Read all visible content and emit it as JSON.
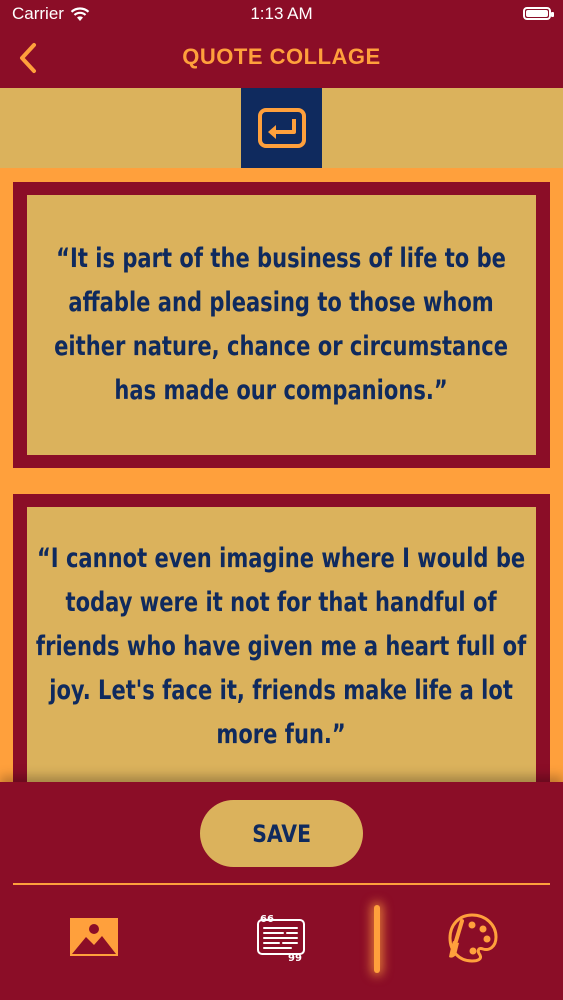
{
  "status": {
    "carrier": "Carrier",
    "time": "1:13 AM"
  },
  "nav": {
    "title": "QUOTE COLLAGE",
    "back_icon": "chevron-left-icon"
  },
  "toolbar": {
    "undo_icon": "undo-return-icon"
  },
  "quotes": [
    "“It is part of the business of life to be affable and pleasing to those whom either nature, chance or circumstance has made our companions.”",
    "“I cannot even imagine where I would be today were it not for that handful of friends who have given me a heart full of joy. Let's face it, friends make life a lot more fun.”"
  ],
  "bottom": {
    "save_label": "SAVE",
    "tabs": [
      {
        "icon": "image-icon"
      },
      {
        "icon": "quote-text-icon"
      },
      {
        "icon": "palette-icon",
        "selected": true
      }
    ]
  },
  "colors": {
    "primary": "#8b0d27",
    "accent": "#ffa03c",
    "sand": "#dbb25c",
    "navy": "#0f2a5e"
  }
}
